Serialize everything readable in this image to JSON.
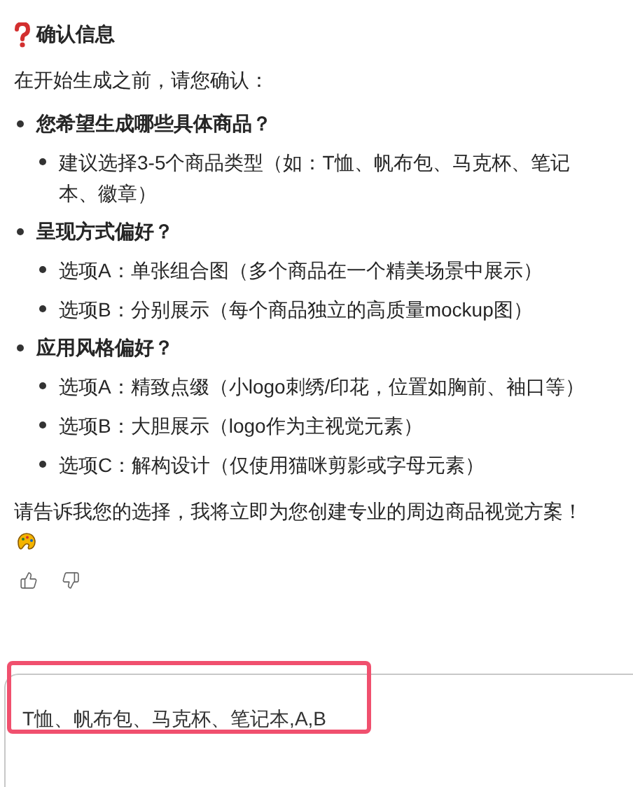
{
  "heading": "确认信息",
  "intro": "在开始生成之前，请您确认：",
  "questions": [
    {
      "text": "您希望生成哪些具体商品？",
      "options": [
        "建议选择3-5个商品类型（如：T恤、帆布包、马克杯、笔记本、徽章）"
      ]
    },
    {
      "text": "呈现方式偏好？",
      "options": [
        "选项A：单张组合图（多个商品在一个精美场景中展示）",
        "选项B：分别展示（每个商品独立的高质量mockup图）"
      ]
    },
    {
      "text": "应用风格偏好？",
      "options": [
        "选项A：精致点缀（小logo刺绣/印花，位置如胸前、袖口等）",
        "选项B：大胆展示（logo作为主视觉元素）",
        "选项C：解构设计（仅使用猫咪剪影或字母元素）"
      ]
    }
  ],
  "closing": "请告诉我您的选择，我将立即为您创建专业的周边商品视觉方案！",
  "input": {
    "value": "T恤、帆布包、马克杯、笔记本,A,B"
  }
}
